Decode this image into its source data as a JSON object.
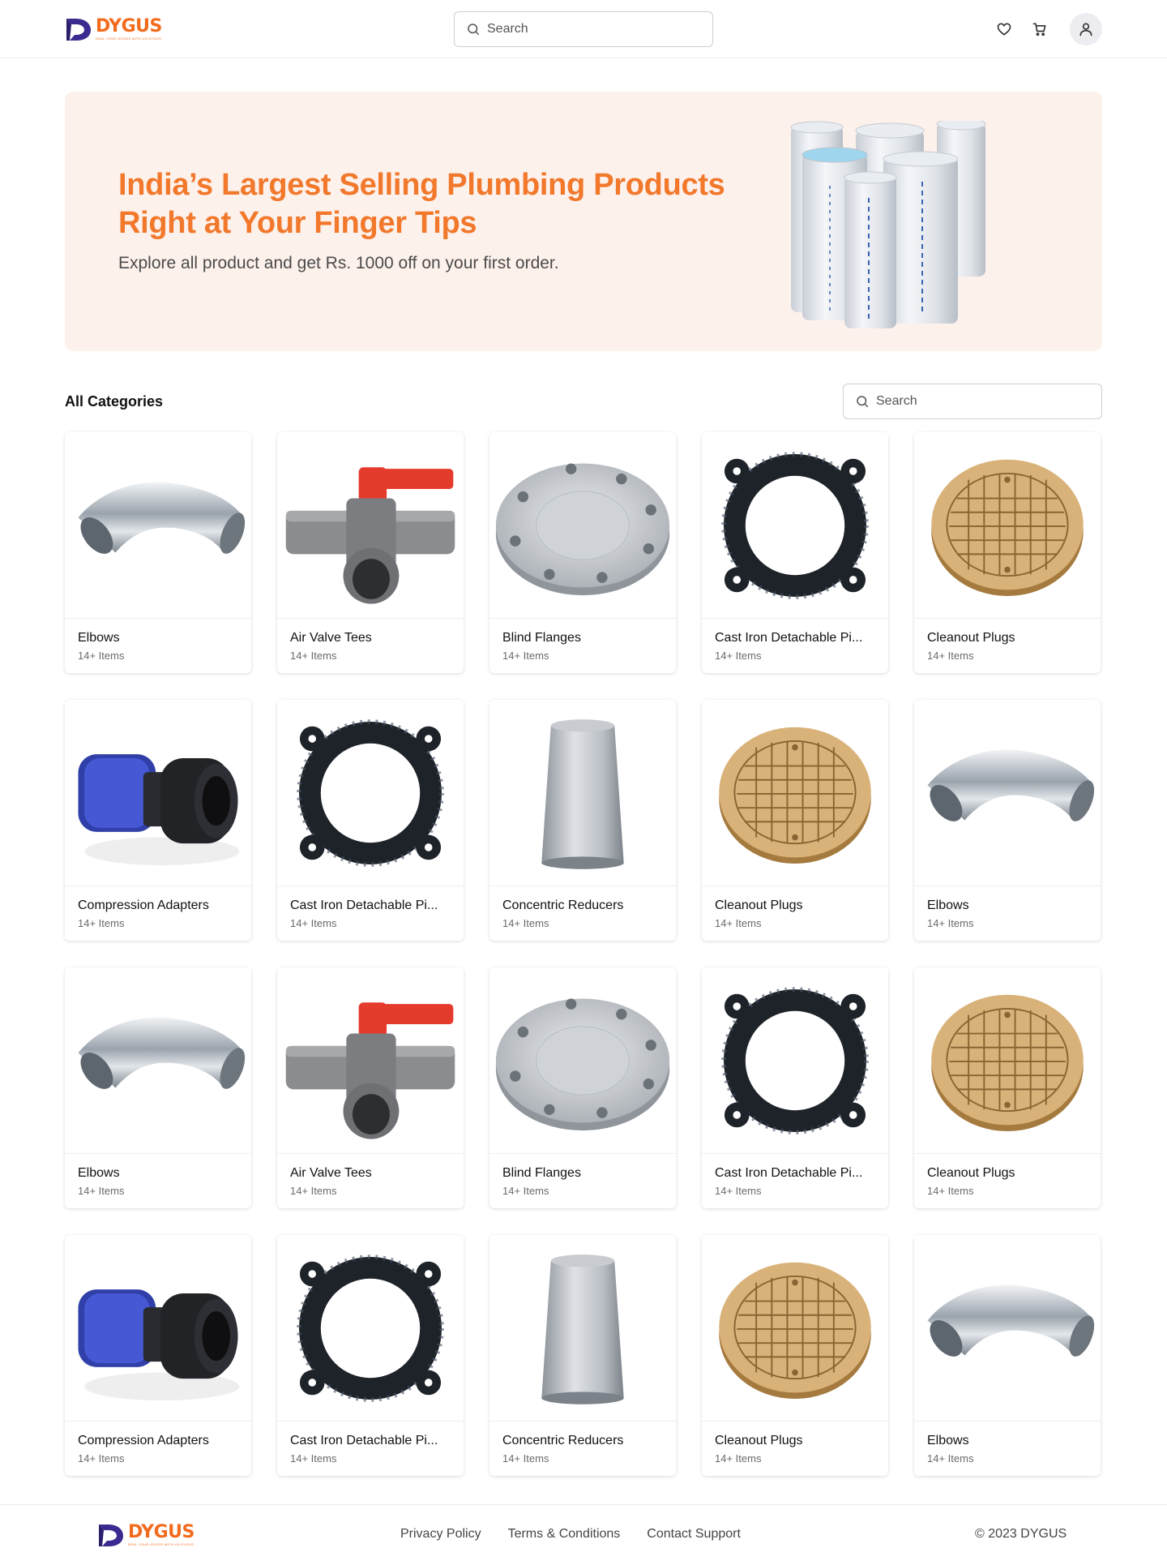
{
  "brand": {
    "name": "DYGUS",
    "tagline": "DEAL YOUR GOODS WITH US DYGUS",
    "accent": "#f26b1d",
    "dark": "#3b2a8f"
  },
  "header": {
    "search_placeholder": "Search"
  },
  "banner": {
    "title": "India’s Largest Selling Plumbing Products Right at Your Finger Tips",
    "subtitle": "Explore all product and get Rs. 1000 off on your first order.",
    "background": "#fdf1ec"
  },
  "categories": {
    "title": "All Categories",
    "search_placeholder": "Search",
    "items": [
      {
        "name": "Elbows",
        "count": "14+ Items",
        "icon": "elbow"
      },
      {
        "name": "Air Valve Tees",
        "count": "14+ Items",
        "icon": "valve"
      },
      {
        "name": "Blind Flanges",
        "count": "14+ Items",
        "icon": "flange"
      },
      {
        "name": "Cast Iron Detachable Pi...",
        "count": "14+ Items",
        "icon": "castiron"
      },
      {
        "name": "Cleanout Plugs",
        "count": "14+ Items",
        "icon": "plug"
      },
      {
        "name": "Compression Adapters",
        "count": "14+ Items",
        "icon": "adapter"
      },
      {
        "name": "Cast Iron Detachable Pi...",
        "count": "14+ Items",
        "icon": "castiron"
      },
      {
        "name": "Concentric Reducers",
        "count": "14+ Items",
        "icon": "reducer"
      },
      {
        "name": "Cleanout Plugs",
        "count": "14+ Items",
        "icon": "plug"
      },
      {
        "name": "Elbows",
        "count": "14+ Items",
        "icon": "elbow"
      },
      {
        "name": "Elbows",
        "count": "14+ Items",
        "icon": "elbow"
      },
      {
        "name": "Air Valve Tees",
        "count": "14+ Items",
        "icon": "valve"
      },
      {
        "name": "Blind Flanges",
        "count": "14+ Items",
        "icon": "flange"
      },
      {
        "name": "Cast Iron Detachable Pi...",
        "count": "14+ Items",
        "icon": "castiron"
      },
      {
        "name": "Cleanout Plugs",
        "count": "14+ Items",
        "icon": "plug"
      },
      {
        "name": "Compression Adapters",
        "count": "14+ Items",
        "icon": "adapter"
      },
      {
        "name": "Cast Iron Detachable Pi...",
        "count": "14+ Items",
        "icon": "castiron"
      },
      {
        "name": "Concentric Reducers",
        "count": "14+ Items",
        "icon": "reducer"
      },
      {
        "name": "Cleanout Plugs",
        "count": "14+ Items",
        "icon": "plug"
      },
      {
        "name": "Elbows",
        "count": "14+ Items",
        "icon": "elbow"
      }
    ]
  },
  "footer": {
    "links": [
      "Privacy Policy",
      "Terms & Conditions",
      "Contact Support"
    ],
    "copyright": "© 2023 DYGUS"
  }
}
